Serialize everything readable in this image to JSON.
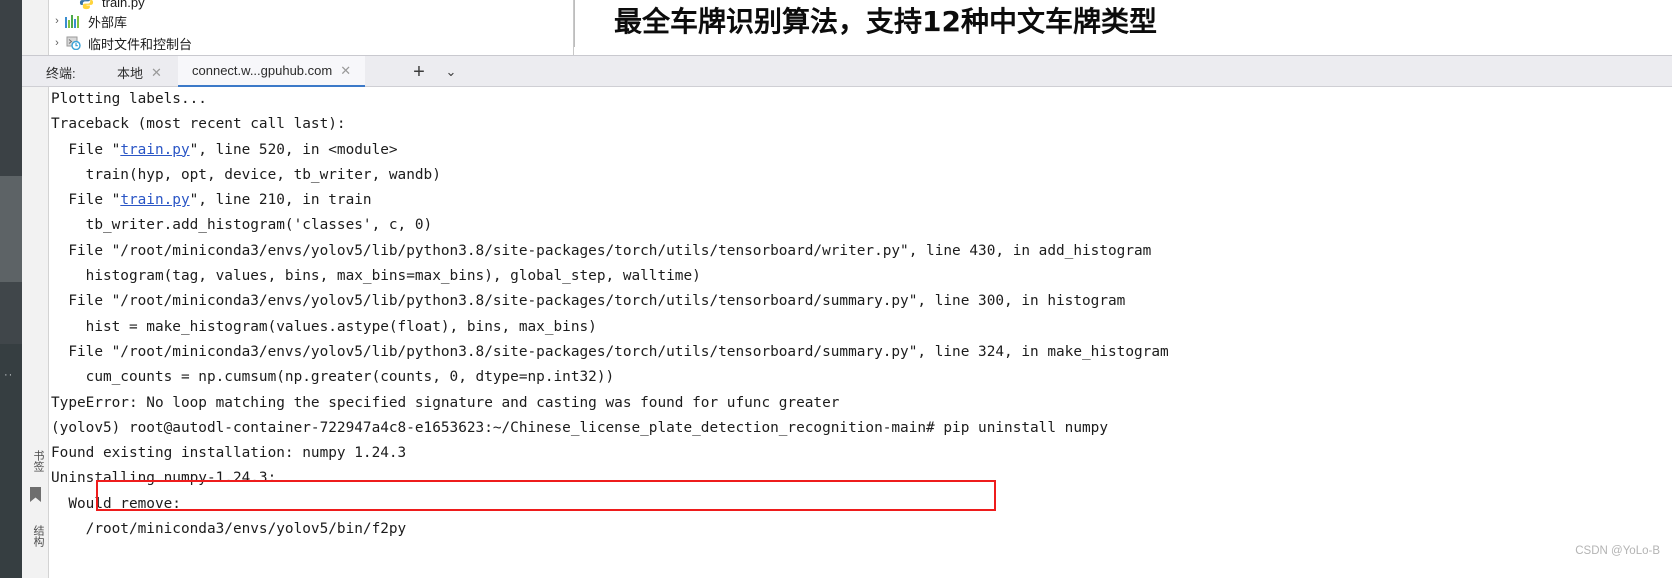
{
  "banner": {
    "text": "最全车牌识别算法，支持12种中文车牌类型"
  },
  "project_tree": {
    "items": [
      {
        "label": "train.py",
        "icon": "python-file-icon",
        "chevron": ""
      },
      {
        "label": "外部库",
        "icon": "external-libraries-icon",
        "chevron": "›"
      },
      {
        "label": "临时文件和控制台",
        "icon": "scratches-consoles-icon",
        "chevron": "›"
      }
    ]
  },
  "tool_strip": {
    "bookmarks_label": "书签",
    "structure_label": "结构",
    "bookmark_icon": "bookmark-icon"
  },
  "terminal_tabbar": {
    "title": "终端:",
    "tabs": [
      {
        "label": "本地",
        "close": "✕",
        "active": false
      },
      {
        "label": "connect.w...gpuhub.com",
        "close": "✕",
        "active": true
      }
    ],
    "add_label": "+",
    "chevron_label": "⌄"
  },
  "terminal": {
    "lines": [
      {
        "text": "Plotting labels..."
      },
      {
        "text": "Traceback (most recent call last):"
      },
      {
        "pre": "  File \"",
        "link": "train.py",
        "post": "\", line 520, in <module>"
      },
      {
        "text": "    train(hyp, opt, device, tb_writer, wandb)"
      },
      {
        "pre": "  File \"",
        "link": "train.py",
        "post": "\", line 210, in train"
      },
      {
        "text": "    tb_writer.add_histogram('classes', c, 0)"
      },
      {
        "text": "  File \"/root/miniconda3/envs/yolov5/lib/python3.8/site-packages/torch/utils/tensorboard/writer.py\", line 430, in add_histogram"
      },
      {
        "text": "    histogram(tag, values, bins, max_bins=max_bins), global_step, walltime)"
      },
      {
        "text": "  File \"/root/miniconda3/envs/yolov5/lib/python3.8/site-packages/torch/utils/tensorboard/summary.py\", line 300, in histogram"
      },
      {
        "text": "    hist = make_histogram(values.astype(float), bins, max_bins)"
      },
      {
        "text": "  File \"/root/miniconda3/envs/yolov5/lib/python3.8/site-packages/torch/utils/tensorboard/summary.py\", line 324, in make_histogram"
      },
      {
        "text": "    cum_counts = np.cumsum(np.greater(counts, 0, dtype=np.int32))"
      },
      {
        "text": "TypeError: No loop matching the specified signature and casting was found for ufunc greater"
      },
      {
        "text": "(yolov5) root@autodl-container-722947a4c8-e1653623:~/Chinese_license_plate_detection_recognition-main# pip uninstall numpy"
      },
      {
        "text": "Found existing installation: numpy 1.24.3"
      },
      {
        "text": "Uninstalling numpy-1.24.3:"
      },
      {
        "text": "  Would remove:"
      },
      {
        "text": "    /root/miniconda3/envs/yolov5/bin/f2py"
      }
    ],
    "error_highlight_color": "#ee1c1c",
    "link_color": "#2a56c6"
  },
  "watermark": {
    "text": "CSDN @YoLo-B"
  }
}
